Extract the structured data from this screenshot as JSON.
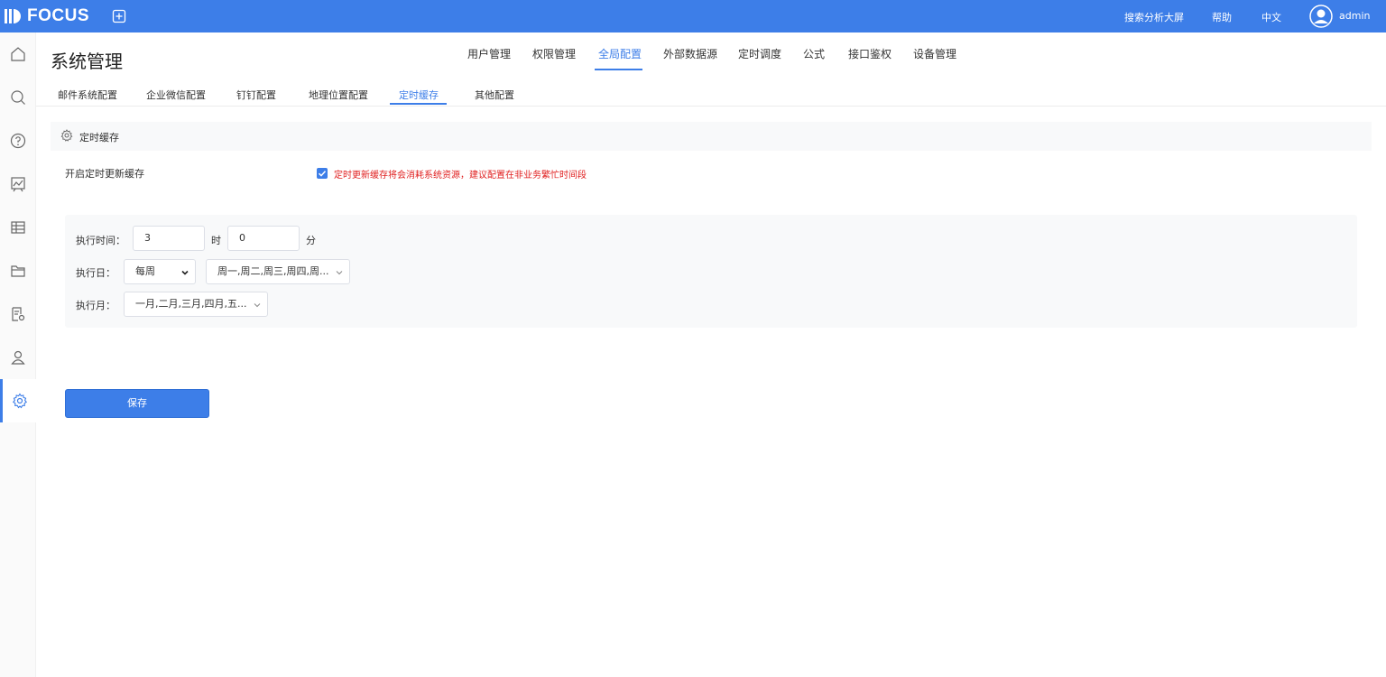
{
  "app": {
    "logo": "FOCUS"
  },
  "topbar": {
    "search_screen": "搜索分析大屏",
    "help": "帮助",
    "language": "中文",
    "user": "admin"
  },
  "header": {
    "title": "系统管理"
  },
  "main_tabs": [
    "用户管理",
    "权限管理",
    "全局配置",
    "外部数据源",
    "定时调度",
    "公式",
    "接口鉴权",
    "设备管理"
  ],
  "main_tab_active": "全局配置",
  "sub_tabs": [
    "邮件系统配置",
    "企业微信配置",
    "钉钉配置",
    "地理位置配置",
    "定时缓存",
    "其他配置"
  ],
  "sub_tab_active": "定时缓存",
  "section": {
    "title": "定时缓存",
    "enable_label": "开启定时更新缓存",
    "enabled": true,
    "warning": "定时更新缓存将会消耗系统资源，建议配置在非业务繁忙时间段"
  },
  "schedule": {
    "time_label": "执行时间：",
    "hour": "3",
    "hour_unit": "时",
    "minute": "0",
    "minute_unit": "分",
    "day_label": "执行日：",
    "frequency": "每周",
    "days": "周一,周二,周三,周四,周...",
    "month_label": "执行月：",
    "months": "一月,二月,三月,四月,五..."
  },
  "save_label": "保存",
  "colors": {
    "primary": "#3d7ee8",
    "warning": "#e02020"
  }
}
